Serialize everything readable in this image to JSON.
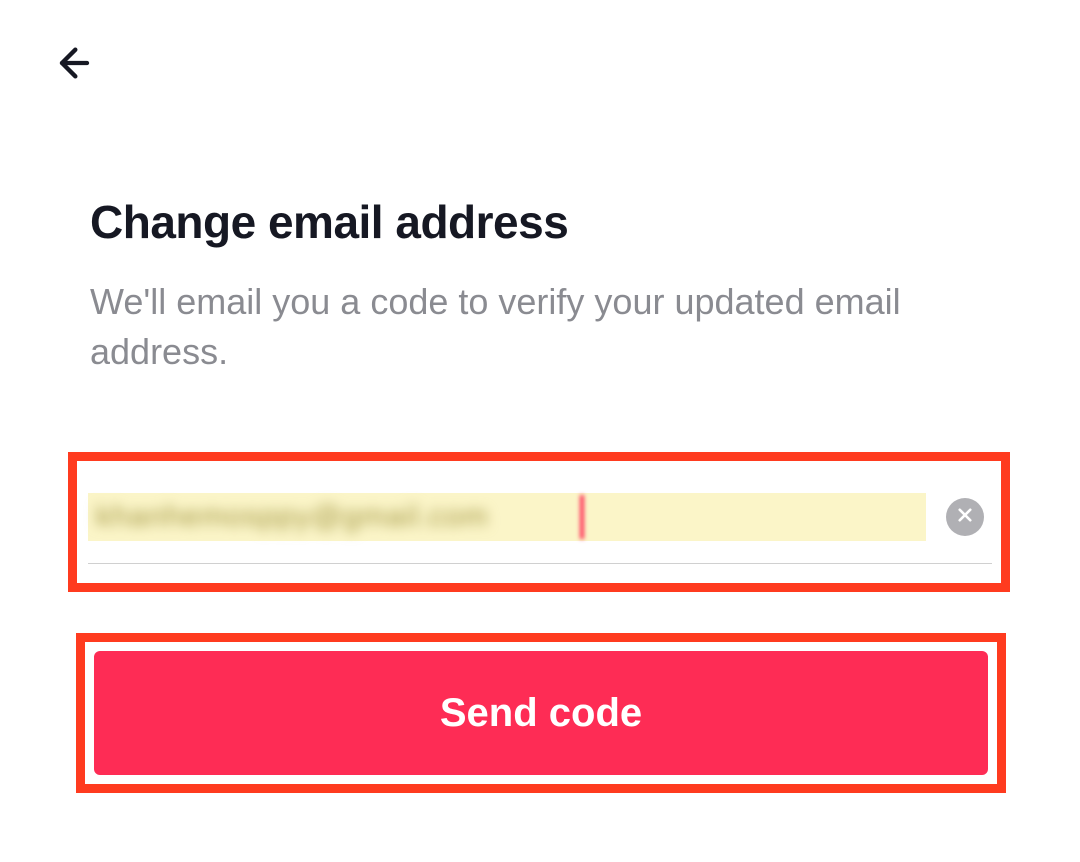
{
  "header": {
    "back_icon": "back-arrow"
  },
  "page": {
    "title": "Change email address",
    "subtitle": "We'll email you a code to verify your updated email address."
  },
  "form": {
    "email_value_redacted": "[redacted email]",
    "clear_icon": "close-x",
    "send_button_label": "Send code"
  },
  "colors": {
    "accent": "#fe2c55",
    "highlight_border": "#ff3b1f",
    "input_bg": "#fbf5c8",
    "text_primary": "#161823",
    "text_secondary": "#8a8b91"
  }
}
